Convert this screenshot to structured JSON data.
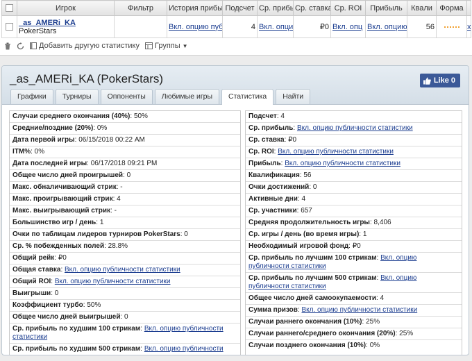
{
  "top_table": {
    "headers": [
      "Игрок",
      "Фильтр",
      "История прибы",
      "Подсчет",
      "Ср. прибы",
      "Ср. ставка",
      "Ср. ROI",
      "Прибыль",
      "Квали",
      "Форма"
    ],
    "row": {
      "player": "_as_AMERi_KA",
      "site": "PokerStars",
      "filter": "",
      "history": "Вкл. опцию публ",
      "count": "4",
      "avg_profit": "Вкл. опци",
      "avg_stake": "₽0",
      "avg_roi": "Вкл. опц",
      "profit": "Вкл. опцию",
      "qual": "56",
      "remove": "x"
    }
  },
  "toolbar": {
    "add_stats": "Добавить другую статистику",
    "groups": "Группы"
  },
  "detail": {
    "title": "_as_AMERi_KA (PokerStars)",
    "like_label": "Like 0",
    "tabs": [
      "Графики",
      "Турниры",
      "Оппоненты",
      "Любимые игры",
      "Статистика",
      "Найти"
    ],
    "active_tab": "Статистика"
  },
  "left_stats": [
    {
      "label": "Случаи среднего окончания (40%)",
      "value": "50%"
    },
    {
      "label": "Средние/поздние (20%)",
      "value": "0%"
    },
    {
      "label": "Дата первой игры",
      "value": "06/15/2018 00:22 AM"
    },
    {
      "label": "ITM%",
      "value": "0%"
    },
    {
      "label": "Дата последней игры",
      "value": "06/17/2018 09:21 PM"
    },
    {
      "label": "Общее число дней проигрышей",
      "value": "0"
    },
    {
      "label": "Макс. обналичивающий стрик",
      "value": "-"
    },
    {
      "label": "Макс. проигрывающий стрик",
      "value": "4"
    },
    {
      "label": "Макс. выигрывающий стрик",
      "value": "-"
    },
    {
      "label": "Большинство игр / день",
      "value": "1"
    },
    {
      "label": "Очки по таблицам лидеров турниров PokerStars",
      "value": "0"
    },
    {
      "label": "Ср. % побежденных полей",
      "value": "28.8%"
    },
    {
      "label": "Общий рейк",
      "value": "₽0"
    },
    {
      "label": "Общая ставка",
      "link": "Вкл. опцию публичности статистики"
    },
    {
      "label": "Общий ROI",
      "link": "Вкл. опцию публичности статистики"
    },
    {
      "label": "Выигрыши",
      "value": "0"
    },
    {
      "label": "Коэффициент турбо",
      "value": "50%"
    },
    {
      "label": "Общее число дней выигрышей",
      "value": "0"
    },
    {
      "label": "Ср. прибыль по худшим 100 стрикам",
      "link": "Вкл. опцию публичности статистики"
    },
    {
      "label": "Ср. прибыль по худшим 500 стрикам",
      "link": "Вкл. опцию публичности статистики"
    }
  ],
  "right_stats": [
    {
      "label": "Подсчет",
      "value": "4"
    },
    {
      "label": "Ср. прибыль",
      "link": "Вкл. опцию публичности статистики"
    },
    {
      "label": "Ср. ставка",
      "value": "₽0"
    },
    {
      "label": "Ср. ROI",
      "link": "Вкл. опцию публичности статистики"
    },
    {
      "label": "Прибыль",
      "link": "Вкл. опцию публичности статистики"
    },
    {
      "label": "Квалификация",
      "value": "56"
    },
    {
      "label": "Очки достижений",
      "value": "0"
    },
    {
      "label": "Активные дни",
      "value": "4"
    },
    {
      "label": "Ср. участники",
      "value": "657"
    },
    {
      "label": "Средняя продолжительность игры",
      "value": "8,406"
    },
    {
      "label": "Ср. игры / день (во время игры)",
      "value": "1"
    },
    {
      "label": "Необходимый игровой фонд",
      "value": "₽0"
    },
    {
      "label": "Ср. прибыль по лучшим 100 стрикам",
      "link": "Вкл. опцию публичности статистики"
    },
    {
      "label": "Ср. прибыль по лучшим 500 стрикам",
      "link": "Вкл. опцию публичности статистики"
    },
    {
      "label": "Общее число дней самоокупаемости",
      "value": "4"
    },
    {
      "label": "Сумма призов",
      "link": "Вкл. опцию публичности статистики"
    },
    {
      "label": "Случаи раннего окончания (10%)",
      "value": "25%"
    },
    {
      "label": "Случаи раннего/среднего окончания (20%)",
      "value": "25%"
    },
    {
      "label": "Случаи позднего окончания (10%)",
      "value": "0%"
    }
  ],
  "colors": {
    "link": "#1a3c8f",
    "facebook": "#3b5998",
    "panel_header": "#d4dee7"
  }
}
